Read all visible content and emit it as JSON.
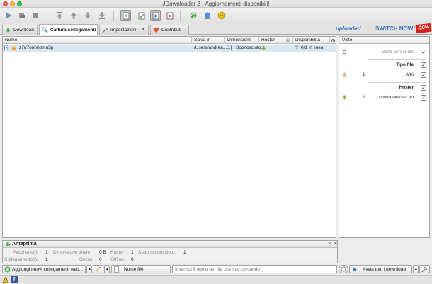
{
  "window": {
    "title": "JDownloader 2 - Aggiornamenti disponibili!"
  },
  "tabs": [
    {
      "label": "Download"
    },
    {
      "label": "Cattura collegamenti"
    },
    {
      "label": "Impostazioni"
    },
    {
      "label": "Contributi"
    }
  ],
  "ad": {
    "brand": "uploaded",
    "cta": "SWITCH NOW!",
    "discount": "-20%"
  },
  "table": {
    "columns": [
      "Nome",
      "Salva in",
      "Dimensione",
      "Hoster",
      "Disponibilità"
    ],
    "rows": [
      {
        "toggle": "[-]",
        "name": "z7u7onh6pmu5p",
        "save_in": "/Users/andrea....",
        "count": "[1]",
        "size": "Sconosciuto",
        "availability": "0/1 in linea"
      }
    ]
  },
  "views": {
    "header": "Viste",
    "personal_view": "Vista personale",
    "file_type_title": "Tipo file",
    "file_type_items": [
      {
        "count": "1",
        "label": "Altri"
      }
    ],
    "hoster_title": "Hoster",
    "hoster_items": [
      {
        "count": "1",
        "label": "nowdownload.eu"
      }
    ]
  },
  "preview": {
    "title": "Anteprima",
    "stats": {
      "packages_label": "Pacchetto(i):",
      "packages": "1",
      "total_size_label": "Dimensione totale:",
      "total_size": "0 B",
      "hoster_label": "Hoster:",
      "hoster": "1",
      "unknown_label": "Stato sconosciuto:",
      "unknown": "1",
      "links_label": "Collegamento(i):",
      "links": "1",
      "online_label": "Online:",
      "online": "0",
      "offline_label": "Offline:",
      "offline": "0"
    }
  },
  "bottom": {
    "add_links": "Aggiungi nuovi collegamenti web...",
    "filter_field": "Nome file",
    "search_placeholder": "Inserisci il nome del file che stai cercando",
    "start_all": "Avvia tutti i download"
  },
  "colors": {
    "accent": "#2d6fb4",
    "selection": "#dbe6f4",
    "badge": "#d6231e"
  }
}
